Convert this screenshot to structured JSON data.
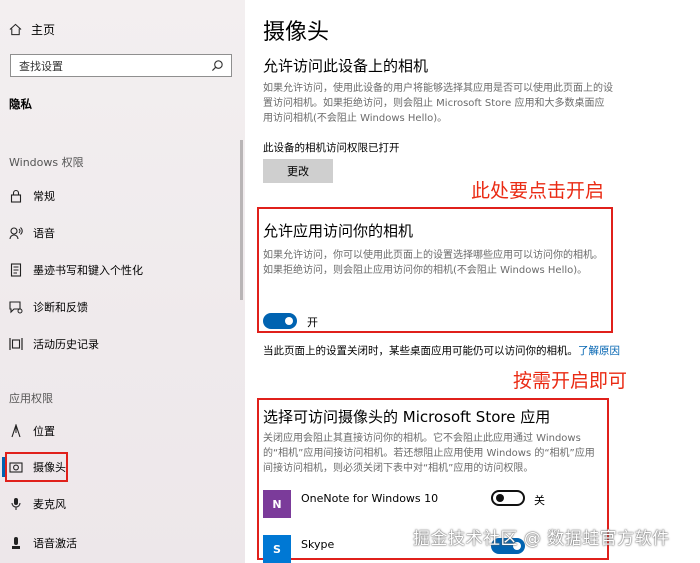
{
  "sidebar": {
    "home_label": "主页",
    "search_placeholder": "查找设置",
    "category": "隐私",
    "group_windows": "Windows 权限",
    "windows_items": [
      {
        "label": "常规",
        "icon": "lock-icon"
      },
      {
        "label": "语音",
        "icon": "speech-icon"
      },
      {
        "label": "墨迹书写和键入个性化",
        "icon": "inking-icon"
      },
      {
        "label": "诊断和反馈",
        "icon": "diagnostics-icon"
      },
      {
        "label": "活动历史记录",
        "icon": "timeline-icon"
      }
    ],
    "group_apps": "应用权限",
    "app_items": [
      {
        "label": "位置",
        "icon": "location-icon"
      },
      {
        "label": "摄像头",
        "icon": "camera-icon",
        "active": true
      },
      {
        "label": "麦克风",
        "icon": "microphone-icon"
      },
      {
        "label": "语音激活",
        "icon": "voice-activation-icon"
      }
    ]
  },
  "main": {
    "title": "摄像头",
    "section1": {
      "heading": "允许访问此设备上的相机",
      "desc": "如果允许访问，使用此设备的用户将能够选择其应用是否可以使用此页面上的设置访问相机。如果拒绝访问，则会阻止 Microsoft Store 应用和大多数桌面应用访问相机(不会阻止 Windows Hello)。",
      "status": "此设备的相机访问权限已打开",
      "button": "更改"
    },
    "annotation1": "此处要点击开启",
    "section2": {
      "heading": "允许应用访问你的相机",
      "desc": "如果允许访问，你可以使用此页面上的设置选择哪些应用可以访问你的相机。如果拒绝访问，则会阻止应用访问你的相机(不会阻止 Windows Hello)。",
      "toggle_state": "开"
    },
    "note": "当此页面上的设置关闭时，某些桌面应用可能仍可以访问你的相机。",
    "note_link": "了解原因",
    "annotation2": "按需开启即可",
    "section3": {
      "heading": "选择可访问摄像头的 Microsoft Store 应用",
      "desc": "关闭应用会阻止其直接访问你的相机。它不会阻止此应用通过 Windows 的“相机”应用间接访问相机。若还想阻止应用使用 Windows 的“相机”应用间接访问相机，则必须关闭下表中对“相机”应用的访问权限。",
      "apps": [
        {
          "name": "OneNote for Windows 10",
          "toggle": "关",
          "icon_letter": "N",
          "color": "#7b3b9a"
        },
        {
          "name": "Skype",
          "toggle": "开",
          "icon_letter": "S",
          "color": "#0078d4"
        }
      ]
    },
    "watermark": "掘金技术社区 @ 数据蛙官方软件"
  },
  "colors": {
    "accent": "#0063b1",
    "annotation": "#ea2b14"
  }
}
